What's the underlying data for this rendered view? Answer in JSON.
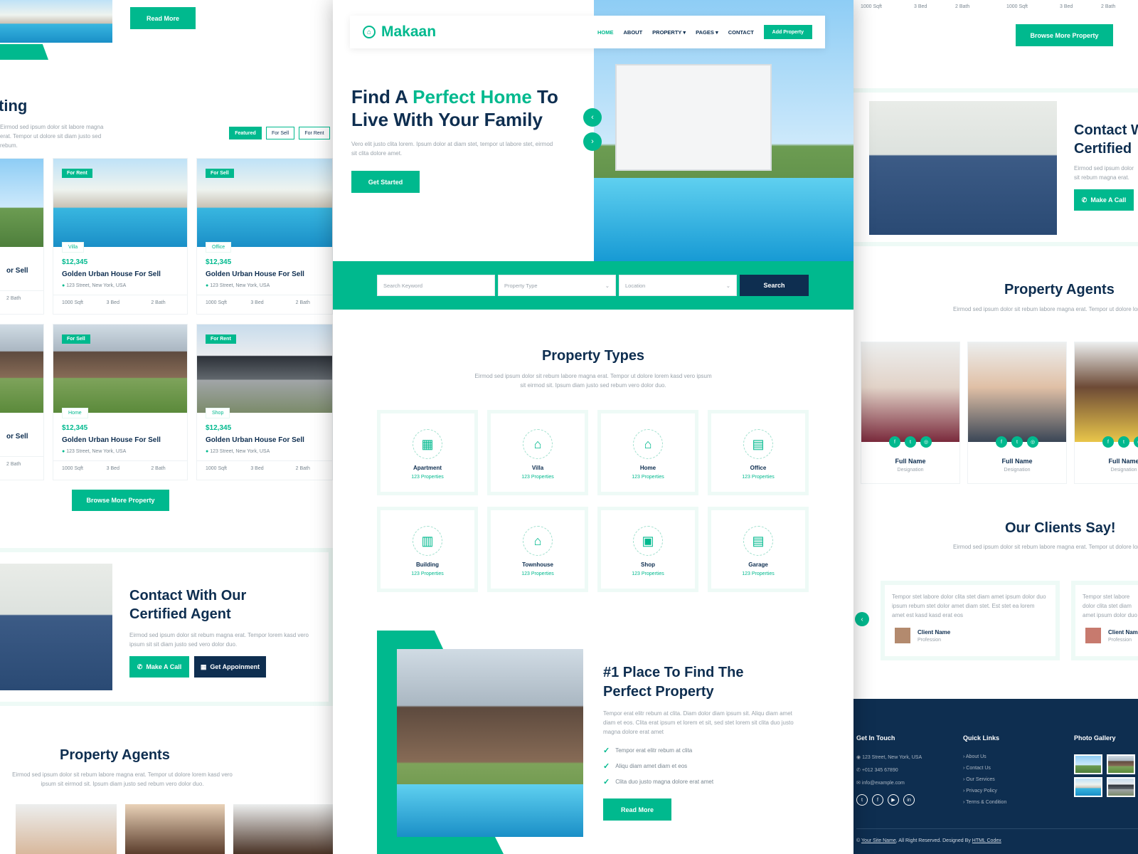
{
  "brand": {
    "name": "Makaan",
    "accent": "#00b98e",
    "dark": "#0e2e50"
  },
  "nav": {
    "items": [
      "HOME",
      "ABOUT",
      "PROPERTY ▾",
      "PAGES ▾",
      "CONTACT"
    ],
    "cta": "Add Property"
  },
  "hero": {
    "title_a": "Find A ",
    "title_highlight": "Perfect Home",
    "title_b": " To",
    "title_line2": "Live With Your Family",
    "text": "Vero elit justo clita lorem. Ipsum dolor at diam stet, tempor ut labore stet, eirmod sit clita dolore amet.",
    "cta": "Get Started"
  },
  "search": {
    "keyword_placeholder": "Search Keyword",
    "type_placeholder": "Property Type",
    "location_placeholder": "Location",
    "button": "Search"
  },
  "types": {
    "title": "Property Types",
    "text": "Eirmod sed ipsum dolor sit rebum labore magna erat. Tempor ut dolore lorem kasd vero ipsum sit eirmod sit. Ipsum diam justo sed rebum vero dolor duo.",
    "items": [
      {
        "name": "Apartment",
        "count": "123 Properties",
        "icon": "apartment-icon"
      },
      {
        "name": "Villa",
        "count": "123 Properties",
        "icon": "villa-icon"
      },
      {
        "name": "Home",
        "count": "123 Properties",
        "icon": "home-icon"
      },
      {
        "name": "Office",
        "count": "123 Properties",
        "icon": "office-icon"
      },
      {
        "name": "Building",
        "count": "123 Properties",
        "icon": "building-icon"
      },
      {
        "name": "Townhouse",
        "count": "123 Properties",
        "icon": "townhouse-icon"
      },
      {
        "name": "Shop",
        "count": "123 Properties",
        "icon": "shop-icon"
      },
      {
        "name": "Garage",
        "count": "123 Properties",
        "icon": "garage-icon"
      }
    ]
  },
  "about": {
    "title_line1": "#1 Place To Find The",
    "title_line2": "Perfect Property",
    "text": "Tempor erat elitr rebum at clita. Diam dolor diam ipsum sit. Aliqu diam amet diam et eos. Clita erat ipsum et lorem et sit, sed stet lorem sit clita duo justo magna dolore erat amet",
    "checks": [
      "Tempor erat elitr rebum at clita",
      "Aliqu diam amet diam et eos",
      "Clita duo justo magna dolore erat amet"
    ],
    "cta": "Read More"
  },
  "left": {
    "top_btn": "Read More",
    "listing_title": "ting",
    "listing_text": "Eirmod sed ipsum dolor sit labore magna erat. Tempor ut dolore sit diam justo sed rebum.",
    "tabs": [
      "Featured",
      "For Sell",
      "For Rent"
    ],
    "cards": [
      {
        "tag": "For Rent",
        "type": "Villa",
        "price": "$12,345",
        "title": "Golden Urban House For Sell",
        "addr": "123 Street, New York, USA",
        "sqft": "1000 Sqft",
        "bed": "3 Bed",
        "bath": "2 Bath"
      },
      {
        "tag": "For Sell",
        "type": "Office",
        "price": "$12,345",
        "title": "Golden Urban House For Sell",
        "addr": "123 Street, New York, USA",
        "sqft": "1000 Sqft",
        "bed": "3 Bed",
        "bath": "2 Bath"
      },
      {
        "tag": "For Sell",
        "type": "Home",
        "price": "$12,345",
        "title": "Golden Urban House For Sell",
        "addr": "123 Street, New York, USA",
        "sqft": "1000 Sqft",
        "bed": "3 Bed",
        "bath": "2 Bath"
      },
      {
        "tag": "For Rent",
        "type": "Shop",
        "price": "$12,345",
        "title": "Golden Urban House For Sell",
        "addr": "123 Street, New York, USA",
        "sqft": "1000 Sqft",
        "bed": "3 Bed",
        "bath": "2 Bath"
      }
    ],
    "partial_card": {
      "title": "or Sell",
      "bath": "2 Bath"
    },
    "browse": "Browse More Property",
    "contact_title_line1": "Contact With Our",
    "contact_title_line2": "Certified Agent",
    "contact_text": "Eirmod sed ipsum dolor sit rebum magna erat. Tempor lorem kasd vero ipsum sit sit diam justo sed vero dolor duo.",
    "call": "Make A Call",
    "appointment": "Get Appoinment",
    "agents_title": "Property Agents",
    "agents_text": "Eirmod sed ipsum dolor sit rebum labore magna erat. Tempor ut dolore lorem kasd vero ipsum sit eirmod sit. Ipsum diam justo sed rebum vero dolor duo."
  },
  "right": {
    "meta": [
      "1000 Sqft",
      "3 Bed",
      "2 Bath",
      "1000 Sqft",
      "3 Bed",
      "2 Bath"
    ],
    "browse": "Browse More Property",
    "contact_title_line1": "Contact W",
    "contact_title_line2": "Certified",
    "contact_text": "Eirmod sed ipsum dolor sit rebum magna erat. Tempor lorem kasd vero ipsum sit.",
    "call": "Make A Call",
    "agents_title": "Property Agents",
    "agents_text": "Eirmod sed ipsum dolor sit rebum labore magna erat. Tempor ut dolore lorem kasd vero ipsum sit eirmod sit. Ipsum diam justo sed rebum vero dolor duo.",
    "agents": [
      {
        "name": "Full Name",
        "role": "Designation"
      },
      {
        "name": "Full Name",
        "role": "Designation"
      },
      {
        "name": "Full Name",
        "role": "Designation"
      }
    ],
    "clients_title": "Our Clients Say!",
    "clients_text": "Eirmod sed ipsum dolor sit rebum labore magna erat. Tempor ut dolore lorem kasd vero ipsum sit eirmod sit. Ipsum diam justo sed rebum vero dolor duo.",
    "testimonials": [
      {
        "text": "Tempor stet labore dolor clita stet diam amet ipsum dolor duo ipsum rebum stet dolor amet diam stet. Est stet ea lorem amet est kasd kasd erat eos",
        "name": "Client Name",
        "role": "Profession"
      },
      {
        "text": "Tempor stet labore dolor clita stet diam amet ipsum dolor duo ipsum",
        "name": "Client Name",
        "role": "Profession"
      }
    ],
    "footer": {
      "touch_title": "Get In Touch",
      "address": "123 Street, New York, USA",
      "phone": "+012 345 67890",
      "email": "info@example.com",
      "links_title": "Quick Links",
      "links": [
        "About Us",
        "Contact Us",
        "Our Services",
        "Privacy Policy",
        "Terms & Condition"
      ],
      "gallery_title": "Photo Gallery",
      "copyright_a": "© ",
      "site": "Your Site Name",
      "copyright_b": ", All Right Reserved. Designed By ",
      "designer": "HTML Codex"
    }
  }
}
